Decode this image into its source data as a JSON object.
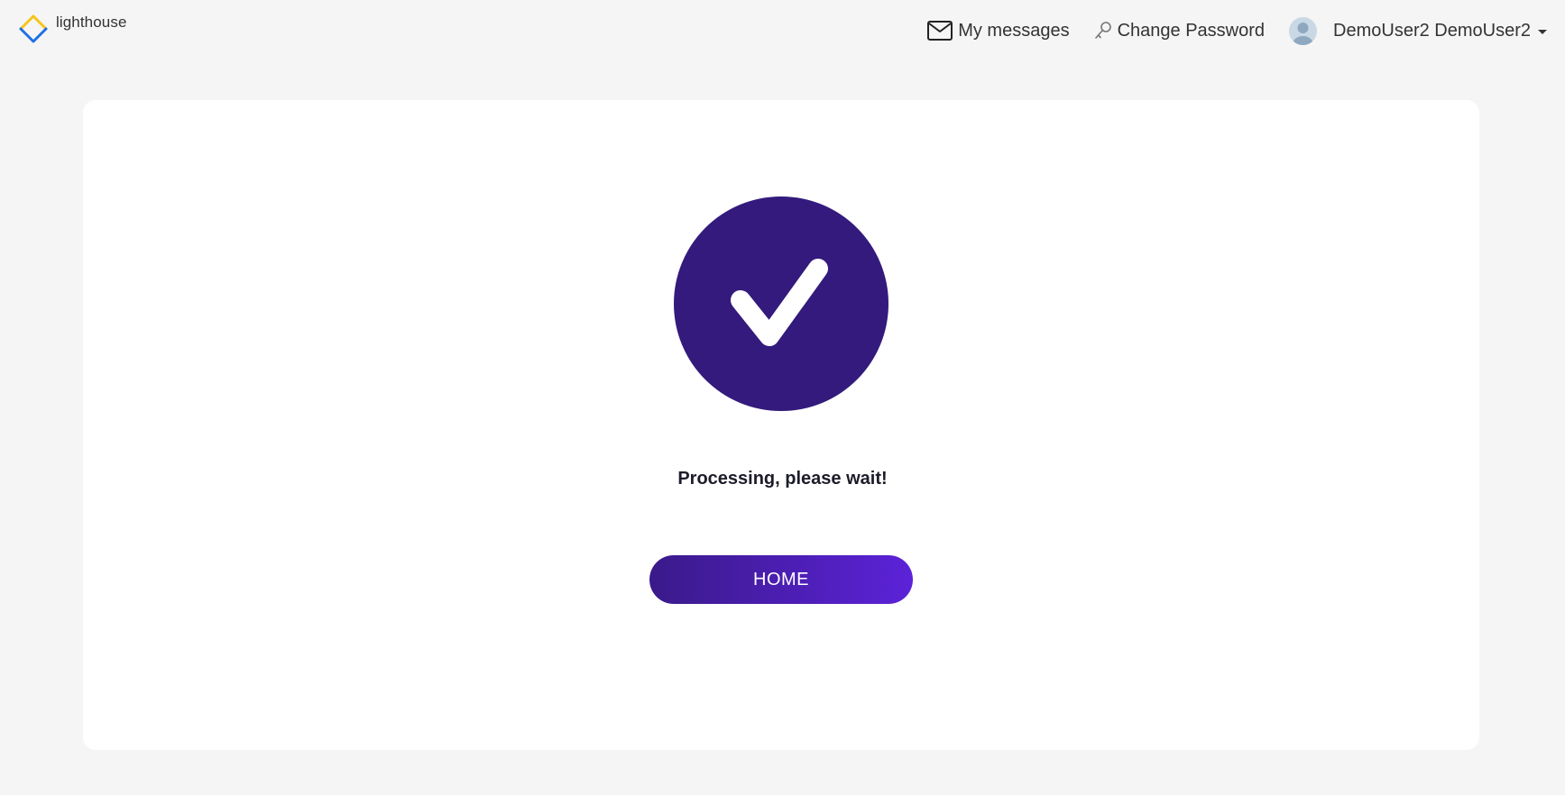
{
  "brand": {
    "name": "lighthouse",
    "icon": "lighthouse-logo-icon",
    "colors": {
      "top": "#f5c518",
      "bottom": "#1f6fe5"
    }
  },
  "nav": {
    "messages_label": "My messages",
    "messages_icon": "envelope-icon",
    "change_password_label": "Change Password",
    "change_password_icon": "key-icon",
    "user_name": "DemoUser2 DemoUser2",
    "avatar_icon": "user-avatar-icon",
    "dropdown_icon": "caret-down-icon"
  },
  "main": {
    "status_icon": "check-circle-icon",
    "status_text": "Processing, please wait!",
    "home_button_label": "HOME"
  },
  "colors": {
    "background": "#f5f5f5",
    "card": "#ffffff",
    "accent": "#331a7c",
    "button_gradient_start": "#3a1a8a",
    "button_gradient_end": "#5c22d8"
  }
}
